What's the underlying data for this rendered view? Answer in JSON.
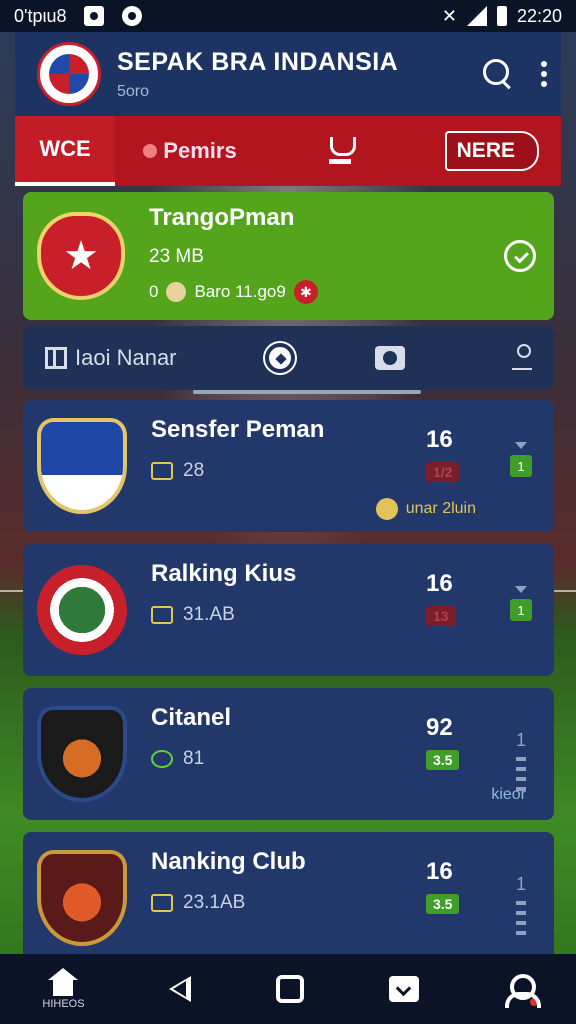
{
  "status_bar": {
    "carrier": "0'tpιu8",
    "time": "22:20"
  },
  "app_bar": {
    "title": "SEPAK BRA INDANSIA",
    "subtitle": "5oro"
  },
  "tabs": [
    {
      "label": "WCE"
    },
    {
      "label": "Pemirs"
    },
    {
      "label": ""
    },
    {
      "label": "NERE"
    }
  ],
  "featured": {
    "name": "TrangoPman",
    "size": "23 MB",
    "meta_prefix": "0",
    "meta_text": "Baro 11.go9"
  },
  "sub_toolbar": {
    "filter_label": "Iaoi Nanar"
  },
  "cards": [
    {
      "name": "Sensfer Peman",
      "stat": "28",
      "number": "16",
      "badge": "1/2",
      "mini": "1",
      "footer": "unar 2luin"
    },
    {
      "name": "Ralking Kius",
      "stat": "31.AB",
      "number": "16",
      "badge": "13",
      "mini": "1",
      "footer": ""
    },
    {
      "name": "Citanel",
      "stat": "81",
      "number": "92",
      "badge": "3.5",
      "mini": "1",
      "footer": "kieor"
    },
    {
      "name": "Nanking Club",
      "stat": "23.1AB",
      "number": "16",
      "badge": "3.5",
      "mini": "1",
      "footer": ""
    }
  ],
  "bottom_nav": {
    "home_label": "HIHEOS"
  },
  "colors": {
    "app_bar": "#1c3363",
    "tab_bar": "#b3151f",
    "featured": "#54a51c",
    "card": "#22386a"
  }
}
